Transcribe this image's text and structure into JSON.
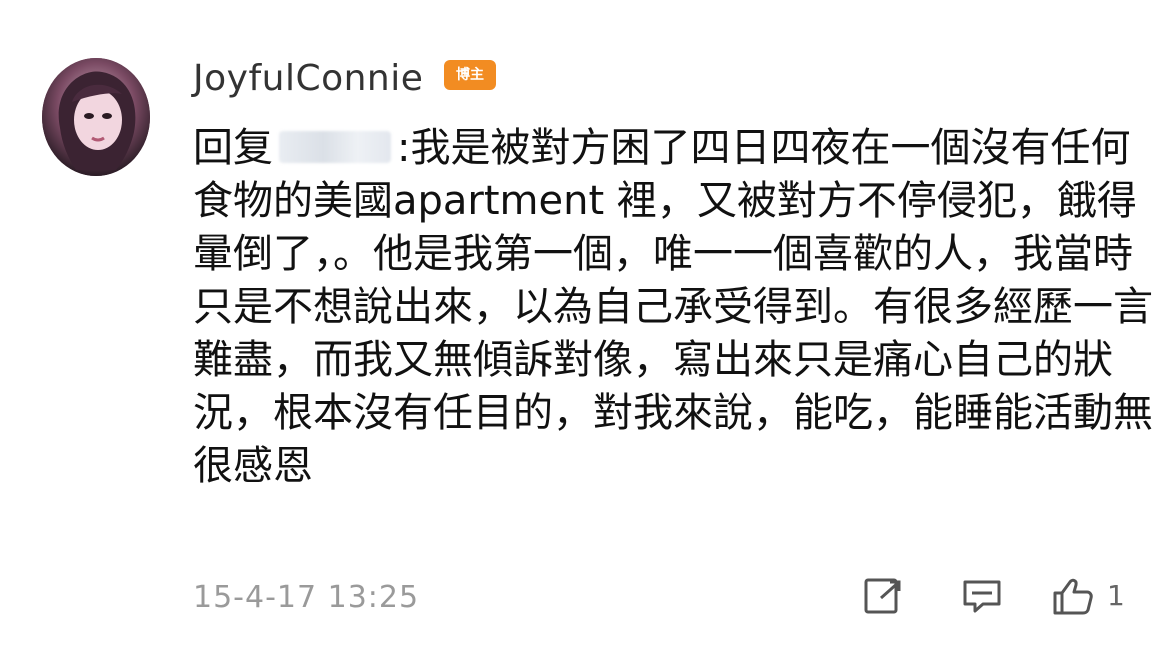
{
  "user": {
    "name": "JoyfulConnie",
    "badge_label": "博主"
  },
  "comment": {
    "reply_prefix": "回复",
    "text": ":我是被對方困了四日四夜在一個沒有任何食物的美國apartment 裡，又被對方不停侵犯，餓得暈倒了，。他是我第一個，唯一一個喜歡的人，我當時只是不想說出來，以為自己承受得到。有很多經歷一言難盡，而我又無傾訴對像，寫出來只是痛心自己的狀況，根本沒有任目的，對我來說，能吃，能睡能活動無很感恩"
  },
  "footer": {
    "timestamp": "15-4-17 13:25",
    "like_count": "1"
  },
  "icons": {
    "share": "share-icon",
    "comment": "comment-icon",
    "like": "thumbs-up-icon"
  },
  "colors": {
    "badge": "#f28c22",
    "text": "#111111",
    "muted": "#9a9a9a"
  }
}
